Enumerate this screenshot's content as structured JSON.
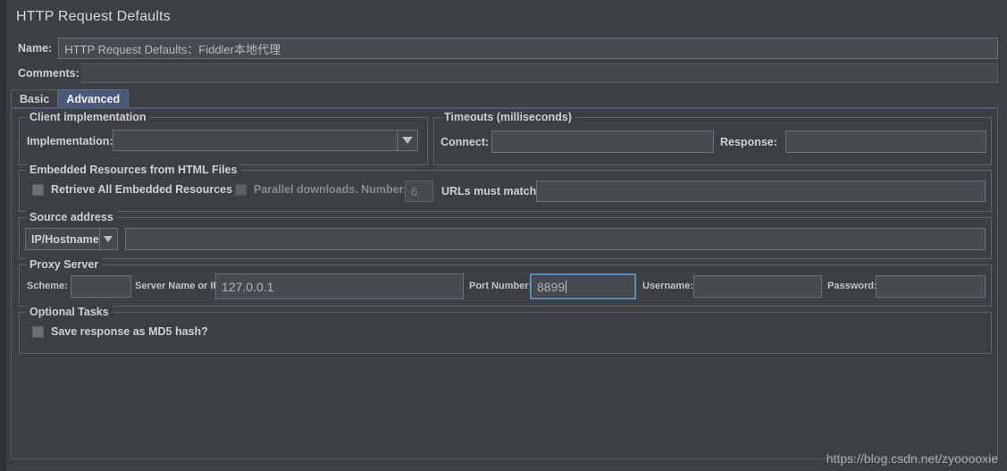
{
  "window": {
    "title": "HTTP Request Defaults"
  },
  "name_row": {
    "label": "Name:",
    "value": "HTTP Request Defaults：Fiddler本地代理"
  },
  "comments_row": {
    "label": "Comments:",
    "value": ""
  },
  "tabs": [
    {
      "label": "Basic",
      "selected": false
    },
    {
      "label": "Advanced",
      "selected": true
    }
  ],
  "client_implementation": {
    "legend": "Client implementation",
    "implementation_label": "Implementation:",
    "implementation_value": "",
    "dropdown_icon": "chevron-down-icon"
  },
  "timeouts": {
    "legend": "Timeouts (milliseconds)",
    "connect_label": "Connect:",
    "connect_value": "",
    "response_label": "Response:",
    "response_value": ""
  },
  "embedded_resources": {
    "legend": "Embedded Resources from HTML Files",
    "retrieve_all_label": "Retrieve All Embedded Resources",
    "retrieve_all_checked": false,
    "parallel_label": "Parallel downloads. Number:",
    "parallel_checked": false,
    "parallel_number": "6",
    "urls_must_match_label": "URLs must match:",
    "urls_must_match_value": ""
  },
  "source_address": {
    "legend": "Source address",
    "type_value": "IP/Hostname",
    "dropdown_icon": "chevron-down-icon",
    "address_value": ""
  },
  "proxy_server": {
    "legend": "Proxy Server",
    "scheme_label": "Scheme:",
    "scheme_value": "",
    "server_label": "Server Name or IP:",
    "server_value": "127.0.0.1",
    "port_label": "Port Number:",
    "port_value": "8899",
    "port_focused": true,
    "username_label": "Username:",
    "username_value": "",
    "password_label": "Password:",
    "password_value": ""
  },
  "optional_tasks": {
    "legend": "Optional Tasks",
    "md5_label": "Save response as MD5 hash?",
    "md5_checked": false
  },
  "watermark": {
    "text": "https://blog.csdn.net/zyooooxie"
  },
  "colors": {
    "background": "#3c4043",
    "field_background": "#474b4f",
    "accent_tab": "#4a5a78",
    "focus_border": "#5590c4",
    "text": "#cdd1d5"
  }
}
